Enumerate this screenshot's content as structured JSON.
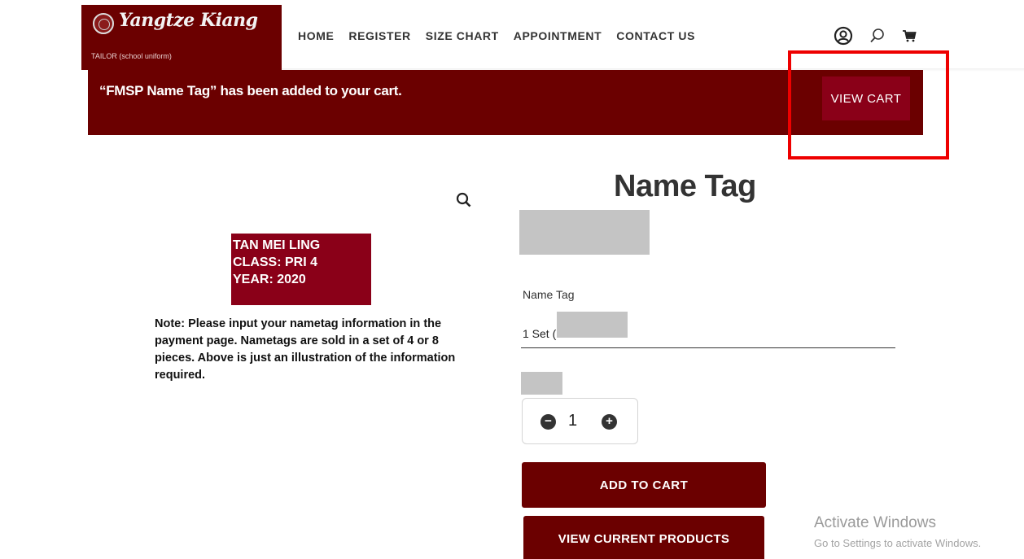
{
  "header": {
    "logo_text": "Yangtze Kiang",
    "logo_subtitle": "TAILOR (school uniform)",
    "nav": [
      "HOME",
      "REGISTER",
      "SIZE CHART",
      "APPOINTMENT",
      "CONTACT US"
    ],
    "icons": [
      "account-icon",
      "search-icon",
      "cart-icon"
    ]
  },
  "notice": {
    "message": "“FMSP Name Tag” has been added to your cart.",
    "button_label": "VIEW CART"
  },
  "product_image": {
    "lines": [
      "TAN MEI LING",
      "CLASS: PRI 4",
      "YEAR: 2020"
    ],
    "note": "Note:  Please input your nametag information in the payment page.  Nametags are sold in a set of 4 or 8 pieces. Above is just an illustration of the information required."
  },
  "product": {
    "title": "Name Tag",
    "option_label": "Name Tag",
    "option_value": "1 Set (",
    "quantity": "1",
    "add_to_cart_label": "ADD TO CART",
    "view_products_label": "VIEW CURRENT PRODUCTS"
  },
  "watermark": {
    "title": "Activate Windows",
    "subtitle": "Go to Settings to activate Windows."
  },
  "colors": {
    "brand": "#6b0000",
    "button_accent": "#8a0018",
    "highlight": "#ee0000"
  }
}
